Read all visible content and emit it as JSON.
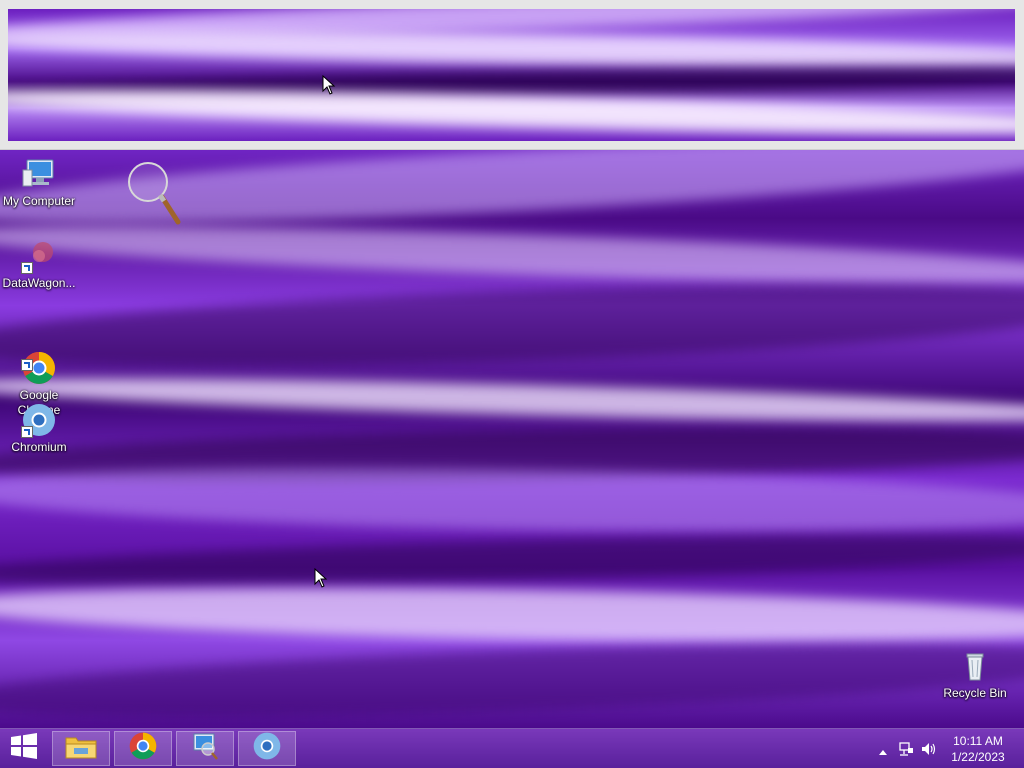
{
  "desktop": {
    "icons": [
      {
        "label": "My Computer",
        "icon": "computer-icon"
      },
      {
        "label": "DataWagon...",
        "icon": "datawagon-icon"
      },
      {
        "label": "Google\nChrome",
        "icon": "chrome-icon"
      },
      {
        "label": "Chromium",
        "icon": "chromium-icon"
      },
      {
        "label": "Recycle Bin",
        "icon": "recycle-bin-icon"
      }
    ],
    "wallpaper_accent": "#7a2cd4"
  },
  "magnifier": {
    "border_color": "#e6e6e6"
  },
  "taskbar": {
    "start_icon": "windows-logo-icon",
    "pinned": [
      {
        "name": "File Explorer",
        "icon": "file-explorer-icon"
      },
      {
        "name": "Google Chrome",
        "icon": "chrome-icon"
      },
      {
        "name": "Magnifier",
        "icon": "magnifier-app-icon"
      },
      {
        "name": "Chromium",
        "icon": "chromium-icon"
      }
    ],
    "tray": {
      "icons": [
        "show-hidden-icons-chevron",
        "network-icon",
        "volume-icon"
      ],
      "time": "10:11 AM",
      "date": "1/22/2023"
    }
  }
}
